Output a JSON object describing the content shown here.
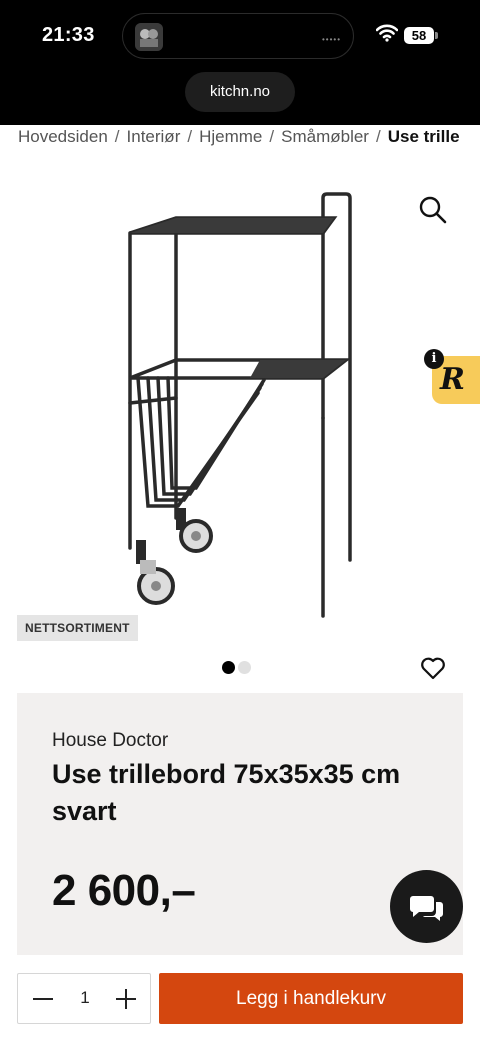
{
  "status_bar": {
    "time": "21:33",
    "battery": "58",
    "url": "kitchn.no",
    "icons": [
      "island-thumbnail-icon",
      "wifi-icon",
      "battery-icon"
    ]
  },
  "breadcrumb": {
    "items": [
      "Hovedsiden",
      "Interiør",
      "Hjemme",
      "Småmøbler"
    ],
    "current": "Use trille",
    "separator": "/"
  },
  "gallery": {
    "tag": "NETTSORTIMENT",
    "total_images": 2,
    "active_index": 0,
    "icons": [
      "zoom-icon",
      "heart-icon"
    ]
  },
  "review_badge": {
    "letter": "R",
    "info": "i",
    "color": "#f7cb5a"
  },
  "product": {
    "brand": "House Doctor",
    "title": "Use trillebord 75x35x35 cm svart",
    "price": "2 600,–"
  },
  "cart": {
    "quantity": "1",
    "add_label": "Legg i handlekurv",
    "accent": "#d4470f"
  }
}
